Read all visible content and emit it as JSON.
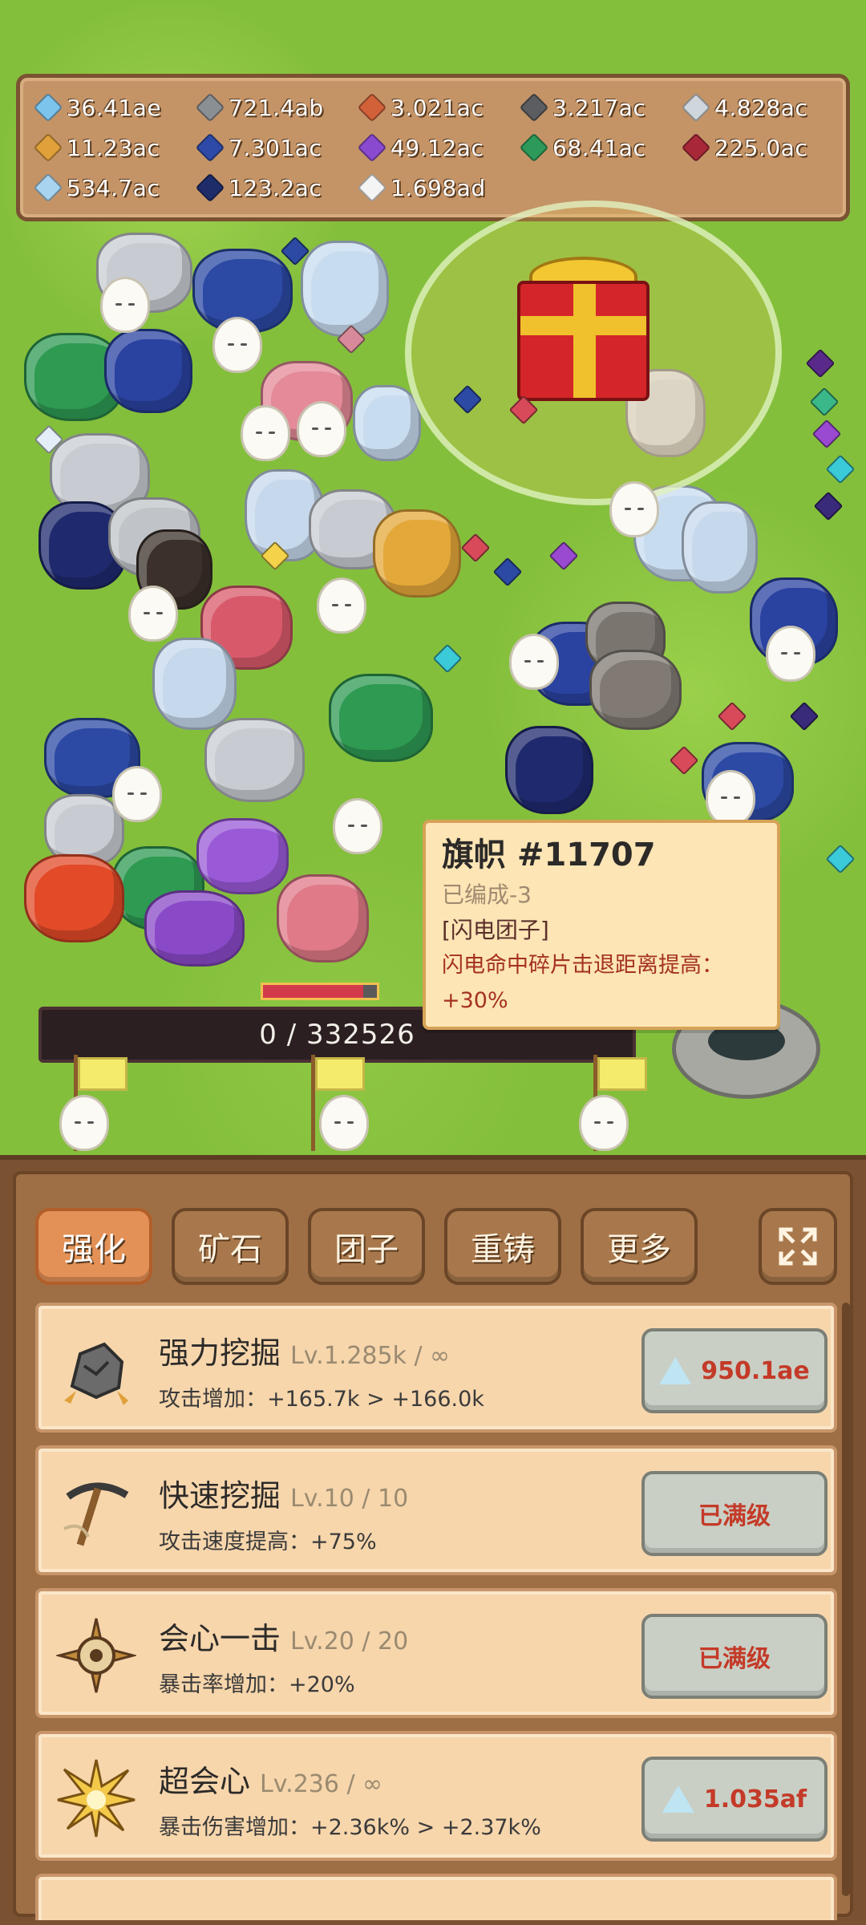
{
  "resources": [
    {
      "icon": "blue-crystal-icon",
      "color": "#7dc4ec",
      "value": "36.41ae"
    },
    {
      "icon": "iron-ingot-icon",
      "color": "#8a8f94",
      "value": "721.4ab"
    },
    {
      "icon": "copper-ingot-icon",
      "color": "#d2613a",
      "value": "3.021ac"
    },
    {
      "icon": "dark-ingot-icon",
      "color": "#5b5d60",
      "value": "3.217ac"
    },
    {
      "icon": "silver-ingot-icon",
      "color": "#cfd6dc",
      "value": "4.828ac"
    },
    {
      "icon": "gold-ingot-icon",
      "color": "#e0a03a",
      "value": "11.23ac"
    },
    {
      "icon": "sapphire-ingot-icon",
      "color": "#2e4aa8",
      "value": "7.301ac"
    },
    {
      "icon": "amethyst-ingot-icon",
      "color": "#8a4ad0",
      "value": "49.12ac"
    },
    {
      "icon": "emerald-ingot-icon",
      "color": "#2e9a5a",
      "value": "68.41ac"
    },
    {
      "icon": "ruby-ingot-icon",
      "color": "#a8283a",
      "value": "225.0ac"
    },
    {
      "icon": "diamond-ingot-icon",
      "color": "#a8d4f0",
      "value": "534.7ac"
    },
    {
      "icon": "navy-ingot-icon",
      "color": "#1f2c6a",
      "value": "123.2ac"
    },
    {
      "icon": "white-gem-icon",
      "color": "#f4f4f4",
      "value": "1.698ad"
    }
  ],
  "progress": {
    "text": "0 / 332526"
  },
  "tooltip": {
    "title": "旗帜 #11707",
    "subtitle": "已编成-3",
    "tag": "[闪电团子]",
    "desc_line1": "闪电命中碎片击退距离提高：",
    "desc_line2": "+30%"
  },
  "tabs": [
    {
      "label": "强化",
      "active": true
    },
    {
      "label": "矿石",
      "active": false
    },
    {
      "label": "团子",
      "active": false
    },
    {
      "label": "重铸",
      "active": false
    },
    {
      "label": "更多",
      "active": false
    }
  ],
  "upgrades": [
    {
      "name": "强力挖掘",
      "level": "Lv.1.285k / ∞",
      "desc": "攻击增加：+165.7k > +166.0k",
      "button": "950.1ae",
      "has_cost": true,
      "icon": "rock-impact-icon"
    },
    {
      "name": "快速挖掘",
      "level": "Lv.10 / 10",
      "desc": "攻击速度提高：+75%",
      "button": "已满级",
      "has_cost": false,
      "icon": "pickaxe-icon"
    },
    {
      "name": "会心一击",
      "level": "Lv.20 / 20",
      "desc": "暴击率增加：+20%",
      "button": "已满级",
      "has_cost": false,
      "icon": "crosshair-icon"
    },
    {
      "name": "超会心",
      "level": "Lv.236 / ∞",
      "desc": "暴击伤害增加：+2.36k% > +2.37k%",
      "button": "1.035af",
      "has_cost": true,
      "icon": "starburst-icon"
    }
  ]
}
